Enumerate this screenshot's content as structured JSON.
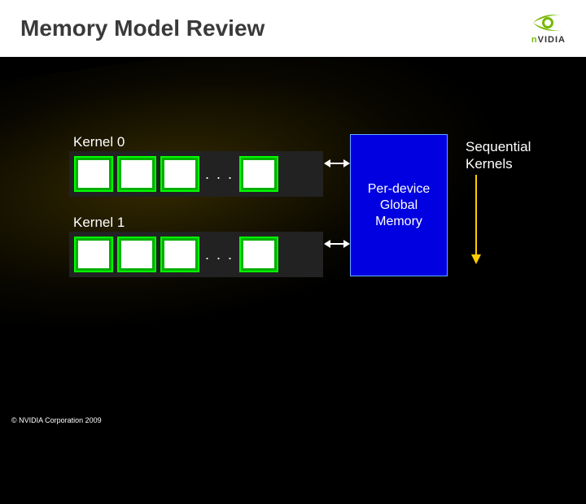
{
  "header": {
    "title": "Memory Model Review",
    "brand_prefix": "n",
    "brand_suffix": "VIDIA"
  },
  "diagram": {
    "kernels": [
      {
        "label": "Kernel 0",
        "ellipsis": ". . ."
      },
      {
        "label": "Kernel 1",
        "ellipsis": ". . ."
      }
    ],
    "global_memory_label": "Per-device Global Memory",
    "sequential_label": "Sequential Kernels"
  },
  "footer": {
    "copyright": "© NVIDIA Corporation 2009"
  },
  "colors": {
    "brand_green": "#76b900",
    "block_green": "#00b000",
    "block_border": "#00ff00",
    "memory_blue": "#0000e0"
  }
}
